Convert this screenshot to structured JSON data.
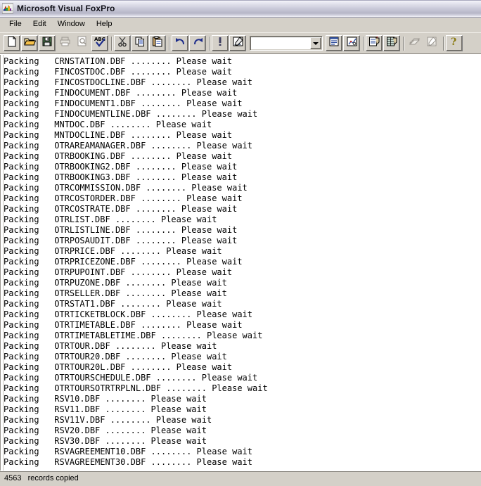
{
  "window": {
    "title": "Microsoft Visual FoxPro",
    "icon": "foxpro-icon"
  },
  "menubar": {
    "items": [
      {
        "label": "File"
      },
      {
        "label": "Edit"
      },
      {
        "label": "Window"
      },
      {
        "label": "Help"
      }
    ]
  },
  "toolbar": {
    "combo": {
      "value": "",
      "placeholder": ""
    },
    "buttons": [
      {
        "name": "new-icon",
        "tooltip": "New",
        "enabled": true
      },
      {
        "name": "open-folder-icon",
        "tooltip": "Open",
        "enabled": true
      },
      {
        "name": "save-diskette-icon",
        "tooltip": "Save",
        "enabled": true
      },
      {
        "name": "print-icon",
        "tooltip": "Print",
        "enabled": false
      },
      {
        "name": "print-preview-icon",
        "tooltip": "Print Preview",
        "enabled": false
      },
      {
        "name": "spelling-abc-icon",
        "tooltip": "Spelling",
        "enabled": true
      },
      {
        "name": "cut-scissors-icon",
        "tooltip": "Cut",
        "enabled": true
      },
      {
        "name": "copy-icon",
        "tooltip": "Copy",
        "enabled": true
      },
      {
        "name": "paste-clipboard-icon",
        "tooltip": "Paste",
        "enabled": true
      },
      {
        "name": "undo-arrow-icon",
        "tooltip": "Undo",
        "enabled": true
      },
      {
        "name": "redo-arrow-icon",
        "tooltip": "Redo",
        "enabled": true
      },
      {
        "name": "run-exclamation-icon",
        "tooltip": "Run",
        "enabled": true
      },
      {
        "name": "build-icon",
        "tooltip": "Modify Form",
        "enabled": true
      },
      {
        "name": "form-designer-icon",
        "tooltip": "Form Designer",
        "enabled": true
      },
      {
        "name": "report-designer-icon",
        "tooltip": "Report Designer",
        "enabled": true
      },
      {
        "name": "database-designer-icon",
        "tooltip": "Database Designer",
        "enabled": true
      },
      {
        "name": "table-designer-icon",
        "tooltip": "Table Designer",
        "enabled": true
      },
      {
        "name": "query-designer-icon",
        "tooltip": "Query Designer",
        "enabled": false
      },
      {
        "name": "view-designer-icon",
        "tooltip": "View Designer",
        "enabled": false
      },
      {
        "name": "help-question-icon",
        "tooltip": "Help",
        "enabled": true
      }
    ]
  },
  "output": {
    "lines": [
      "Packing   CRNSTATION.DBF ........ Please wait",
      "Packing   FINCOSTDOC.DBF ........ Please wait",
      "Packing   FINCOSTDOCLINE.DBF ........ Please wait",
      "Packing   FINDOCUMENT.DBF ........ Please wait",
      "Packing   FINDOCUMENT1.DBF ........ Please wait",
      "Packing   FINDOCUMENTLINE.DBF ........ Please wait",
      "Packing   MNTDOC.DBF ........ Please wait",
      "Packing   MNTDOCLINE.DBF ........ Please wait",
      "Packing   OTRAREAMANAGER.DBF ........ Please wait",
      "Packing   OTRBOOKING.DBF ........ Please wait",
      "Packing   OTRBOOKING2.DBF ........ Please wait",
      "Packing   OTRBOOKING3.DBF ........ Please wait",
      "Packing   OTRCOMMISSION.DBF ........ Please wait",
      "Packing   OTRCOSTORDER.DBF ........ Please wait",
      "Packing   OTRCOSTRATE.DBF ........ Please wait",
      "Packing   OTRLIST.DBF ........ Please wait",
      "Packing   OTRLISTLINE.DBF ........ Please wait",
      "Packing   OTRPOSAUDIT.DBF ........ Please wait",
      "Packing   OTRPRICE.DBF ........ Please wait",
      "Packing   OTRPRICEZONE.DBF ........ Please wait",
      "Packing   OTRPUPOINT.DBF ........ Please wait",
      "Packing   OTRPUZONE.DBF ........ Please wait",
      "Packing   OTRSELLER.DBF ........ Please wait",
      "Packing   OTRSTAT1.DBF ........ Please wait",
      "Packing   OTRTICKETBLOCK.DBF ........ Please wait",
      "Packing   OTRTIMETABLE.DBF ........ Please wait",
      "Packing   OTRTIMETABLETIME.DBF ........ Please wait",
      "Packing   OTRTOUR.DBF ........ Please wait",
      "Packing   OTRTOUR20.DBF ........ Please wait",
      "Packing   OTRTOUR20L.DBF ........ Please wait",
      "Packing   OTRTOURSCHEDULE.DBF ........ Please wait",
      "Packing   OTRTOURSOTRTRPLNL.DBF ........ Please wait",
      "Packing   RSV10.DBF ........ Please wait",
      "Packing   RSV11.DBF ........ Please wait",
      "Packing   RSV11V.DBF ........ Please wait",
      "Packing   RSV20.DBF ........ Please wait",
      "Packing   RSV30.DBF ........ Please wait",
      "Packing   RSVAGREEMENT10.DBF ........ Please wait",
      "Packing   RSVAGREEMENT30.DBF ........ Please wait"
    ]
  },
  "statusbar": {
    "message": "4563   records copied"
  },
  "colors": {
    "window_face": "#d4d0c8",
    "client_bg": "#ffffff",
    "text": "#000000",
    "shadow": "#86837c",
    "highlight": "#ffffff"
  }
}
